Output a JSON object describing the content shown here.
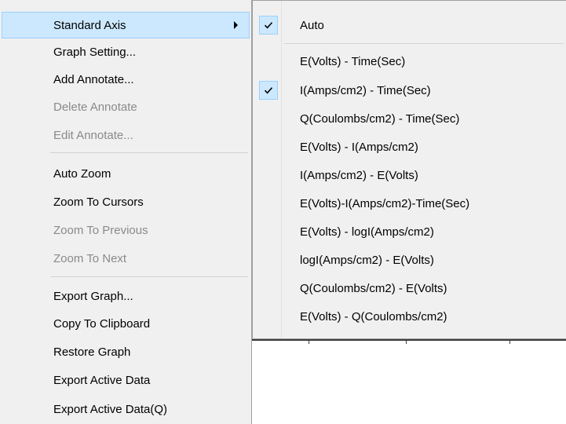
{
  "main_menu": {
    "items": [
      {
        "label": "Standard Axis",
        "enabled": true,
        "highlighted": true,
        "has_submenu": true
      },
      {
        "label": "Graph Setting...",
        "enabled": true
      },
      {
        "label": "Add Annotate...",
        "enabled": true
      },
      {
        "label": "Delete Annotate",
        "enabled": false
      },
      {
        "label": "Edit Annotate...",
        "enabled": false
      },
      {
        "label": "Auto Zoom",
        "enabled": true
      },
      {
        "label": "Zoom To Cursors",
        "enabled": true
      },
      {
        "label": "Zoom To Previous",
        "enabled": false
      },
      {
        "label": "Zoom To Next",
        "enabled": false
      },
      {
        "label": "Export Graph...",
        "enabled": true
      },
      {
        "label": "Copy To Clipboard",
        "enabled": true
      },
      {
        "label": "Restore Graph",
        "enabled": true
      },
      {
        "label": "Export Active Data",
        "enabled": true
      },
      {
        "label": "Export Active Data(Q)",
        "enabled": true
      }
    ]
  },
  "sub_menu": {
    "items": [
      {
        "label": "Auto",
        "checked": true
      },
      {
        "label": "E(Volts) - Time(Sec)",
        "checked": false
      },
      {
        "label": "I(Amps/cm2) - Time(Sec)",
        "checked": true
      },
      {
        "label": "Q(Coulombs/cm2) - Time(Sec)",
        "checked": false
      },
      {
        "label": "E(Volts) - I(Amps/cm2)",
        "checked": false
      },
      {
        "label": "I(Amps/cm2) - E(Volts)",
        "checked": false
      },
      {
        "label": "E(Volts)-I(Amps/cm2)-Time(Sec)",
        "checked": false
      },
      {
        "label": "E(Volts) - logI(Amps/cm2)",
        "checked": false
      },
      {
        "label": "logI(Amps/cm2) - E(Volts)",
        "checked": false
      },
      {
        "label": "Q(Coulombs/cm2) - E(Volts)",
        "checked": false
      },
      {
        "label": "E(Volts) - Q(Coulombs/cm2)",
        "checked": false
      }
    ]
  },
  "colors": {
    "menu_background": "#f0f0f0",
    "highlight_fill": "#cce8ff",
    "highlight_border": "#99d1ff",
    "disabled_text": "#8a8a8a",
    "separator": "#d2d2d2"
  },
  "icons": {
    "submenu_arrow": "triangle-right-icon",
    "check": "checkmark-icon"
  }
}
